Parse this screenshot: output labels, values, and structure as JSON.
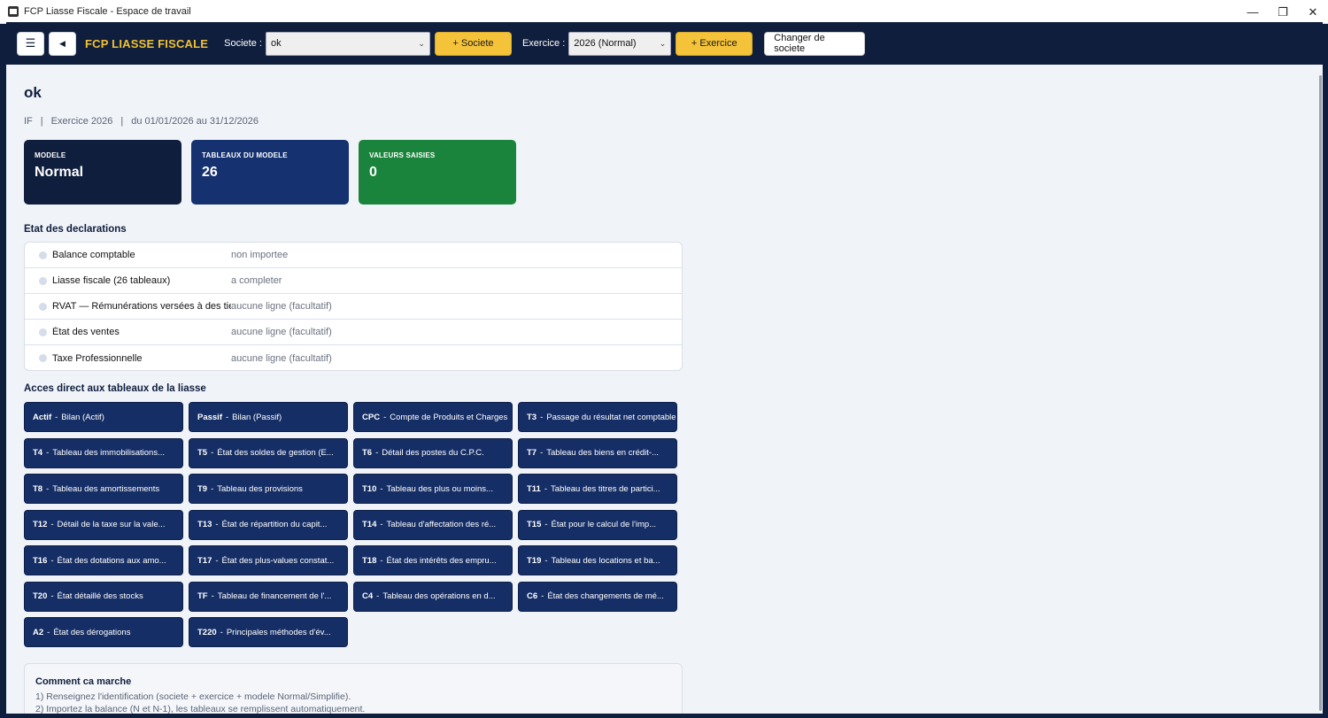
{
  "window": {
    "title": "FCP Liasse Fiscale - Espace de travail",
    "controls": {
      "minimize": "—",
      "restore": "❐",
      "close": "✕"
    }
  },
  "header": {
    "menu_icon": "☰",
    "back_icon": "◀",
    "brand": "FCP LIASSE FISCALE",
    "societe_label": "Societe :",
    "societe_value": "ok",
    "add_societe": "+ Societe",
    "exercice_label": "Exercice :",
    "exercice_value": "2026 (Normal)",
    "add_exercice": "+ Exercice",
    "change_societe": "Changer de societe",
    "chevron": "⌄"
  },
  "page": {
    "title": "ok",
    "sub": {
      "id": "IF",
      "sep": "|",
      "exercice": "Exercice 2026",
      "period": "du 01/01/2026 au 31/12/2026"
    }
  },
  "kpis": [
    {
      "label": "MODELE",
      "value": "Normal",
      "color": "#0f1e3d"
    },
    {
      "label": "TABLEAUX DU MODELE",
      "value": "26",
      "color": "#153170"
    },
    {
      "label": "VALEURS SAISIES",
      "value": "0",
      "color": "#1b843c"
    }
  ],
  "declarations": {
    "title": "Etat des declarations",
    "rows": [
      {
        "name": "Balance comptable",
        "status": "non importee"
      },
      {
        "name": "Liasse fiscale (26 tableaux)",
        "status": "a completer"
      },
      {
        "name": "RVAT — Rémunérations versées à des tiers",
        "status": "aucune ligne (facultatif)"
      },
      {
        "name": "État des ventes",
        "status": "aucune ligne (facultatif)"
      },
      {
        "name": "Taxe Professionnelle",
        "status": "aucune ligne (facultatif)"
      }
    ]
  },
  "tables": {
    "title": "Acces direct aux tableaux de la liasse",
    "items": [
      {
        "code": "Actif",
        "label": "Bilan (Actif)"
      },
      {
        "code": "Passif",
        "label": "Bilan (Passif)"
      },
      {
        "code": "CPC",
        "label": "Compte de Produits et Charges"
      },
      {
        "code": "T3",
        "label": "Passage du résultat net comptable"
      },
      {
        "code": "T4",
        "label": "Tableau des immobilisations..."
      },
      {
        "code": "T5",
        "label": "État des soldes de gestion (E..."
      },
      {
        "code": "T6",
        "label": "Détail des postes du C.P.C."
      },
      {
        "code": "T7",
        "label": "Tableau des biens en crédit-..."
      },
      {
        "code": "T8",
        "label": "Tableau des amortissements"
      },
      {
        "code": "T9",
        "label": "Tableau des provisions"
      },
      {
        "code": "T10",
        "label": "Tableau des plus ou moins..."
      },
      {
        "code": "T11",
        "label": "Tableau des titres de partici..."
      },
      {
        "code": "T12",
        "label": "Détail de la taxe sur la vale..."
      },
      {
        "code": "T13",
        "label": "État de répartition du capit..."
      },
      {
        "code": "T14",
        "label": "Tableau d'affectation des ré..."
      },
      {
        "code": "T15",
        "label": "État pour le calcul de l'imp..."
      },
      {
        "code": "T16",
        "label": "État des dotations aux amo..."
      },
      {
        "code": "T17",
        "label": "État des plus-values constat..."
      },
      {
        "code": "T18",
        "label": "État des intérêts des empru..."
      },
      {
        "code": "T19",
        "label": "Tableau des locations et ba..."
      },
      {
        "code": "T20",
        "label": "État détaillé des stocks"
      },
      {
        "code": "TF",
        "label": "Tableau de financement de l'..."
      },
      {
        "code": "C4",
        "label": "Tableau des opérations en d..."
      },
      {
        "code": "C6",
        "label": "État des changements de mé..."
      },
      {
        "code": "A2",
        "label": "État des dérogations"
      },
      {
        "code": "T220",
        "label": "Principales méthodes d'év..."
      }
    ]
  },
  "help": {
    "title": "Comment ca marche",
    "lines": [
      "1) Renseignez l'identification (societe + exercice + modele Normal/Simplifie).",
      "2) Importez la balance (N et N-1), les tableaux se remplissent automatiquement."
    ]
  }
}
